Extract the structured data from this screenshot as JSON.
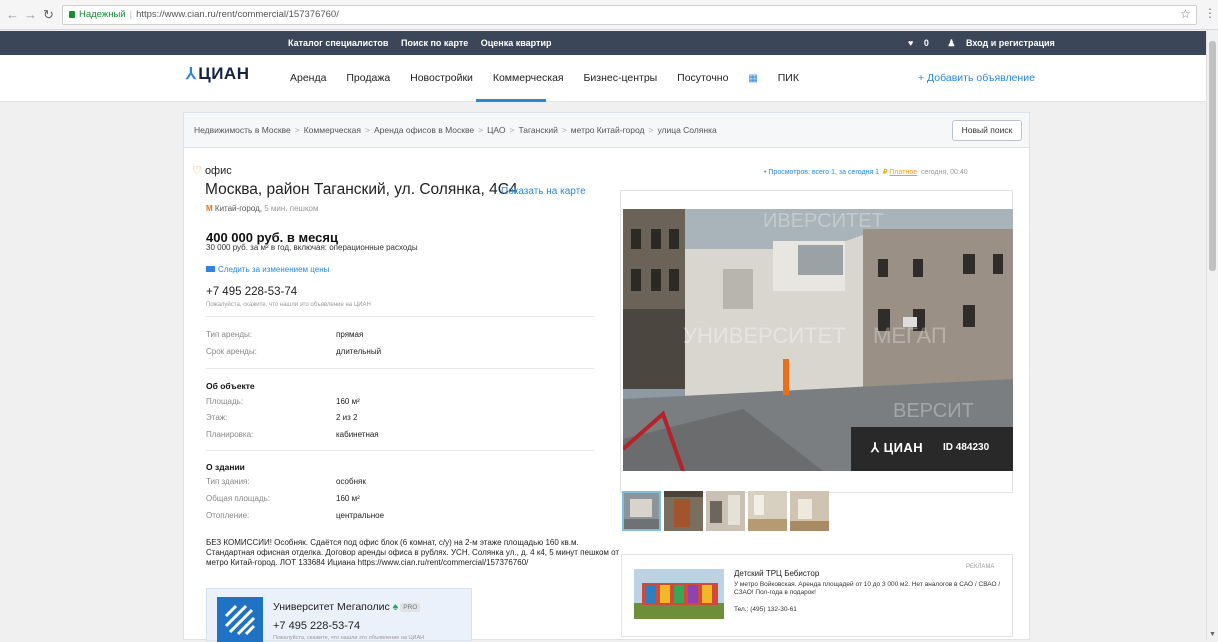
{
  "browser": {
    "secure_label": "Надежный",
    "url": "https://www.cian.ru/rent/commercial/157376760/"
  },
  "topbar": {
    "links": [
      "Каталог специалистов",
      "Поиск по карте",
      "Оценка квартир"
    ],
    "favorites_count": "0",
    "login": "Вход и регистрация"
  },
  "header": {
    "logo": "ЦИАН",
    "nav": [
      "Аренда",
      "Продажа",
      "Новостройки",
      "Коммерческая",
      "Бизнес-центры",
      "Посуточно"
    ],
    "active_nav": "Коммерческая",
    "pik": "ПИК",
    "add_ad": "+ Добавить объявление"
  },
  "breadcrumbs": {
    "items": [
      "Недвижимость в Москве",
      "Коммерческая",
      "Аренда офисов в Москве",
      "ЦАО",
      "Таганский",
      "метро Китай-город",
      "улица Солянка"
    ],
    "new_search": "Новый поиск"
  },
  "offer": {
    "type": "офис",
    "address": "Москва, район Таганский, ул. Солянка, 4С4",
    "map_link": "Показать на карте",
    "metro": "Китай-город,",
    "metro_walk": "5 мин. пешком",
    "price": "400 000 руб. в месяц",
    "price_sub": "30 000 руб. за м² в год, включая: операционные расходы",
    "follow_price": "Следить за изменением цены",
    "phone": "+7 495 228-53-74",
    "phone_hint": "Пожалуйста, скажите, что нашли это объявление на ЦИАН",
    "rent": [
      {
        "k": "Тип аренды:",
        "v": "прямая"
      },
      {
        "k": "Срок аренды:",
        "v": "длительный"
      }
    ],
    "object_title": "Об объекте",
    "object": [
      {
        "k": "Площадь:",
        "v": "160 м²"
      },
      {
        "k": "Этаж:",
        "v": "2 из 2"
      },
      {
        "k": "Планировка:",
        "v": "кабинетная"
      }
    ],
    "building_title": "О здании",
    "building": [
      {
        "k": "Тип здания:",
        "v": "особняк"
      },
      {
        "k": "Общая площадь:",
        "v": "160 м²"
      },
      {
        "k": "Отопление:",
        "v": "центральное"
      }
    ],
    "description": "БЕЗ КОМИССИИ! Особняк. Сдаётся под офис блок (6 комнат, с/у) на 2-м этаже площадью 160 кв.м. Стандартная офисная отделка. Договор аренды офиса в рублях. УСН. Солянка ул., д. 4 к4, 5 минут пешком от метро Китай-город. ЛОТ 133684 Ициана https://www.cian.ru/rent/commercial/157376760/",
    "stats": "• Просмотров: всего 1, за сегодня 1",
    "paid": "Платное",
    "date": "сегодня, 00:40"
  },
  "agent": {
    "name": "Университет Мегаполис",
    "badge": "PRO",
    "phone": "+7 495 228-53-74",
    "hint": "Пожалуйста, скажите, что нашли это объявление на ЦИАН"
  },
  "photo": {
    "badge_logo": "ЦИАН",
    "badge_id": "ID 484230"
  },
  "ad": {
    "label": "РЕКЛАМА",
    "title": "Детский ТРЦ Бебистор",
    "text": "У метро Войковская. Аренда площадей от 10 до 3 000 м2. Нет аналогов в САО / СВАО / СЗАО! Пол-года в подарок!",
    "phone": "Тел.: (495) 132-30-61"
  }
}
